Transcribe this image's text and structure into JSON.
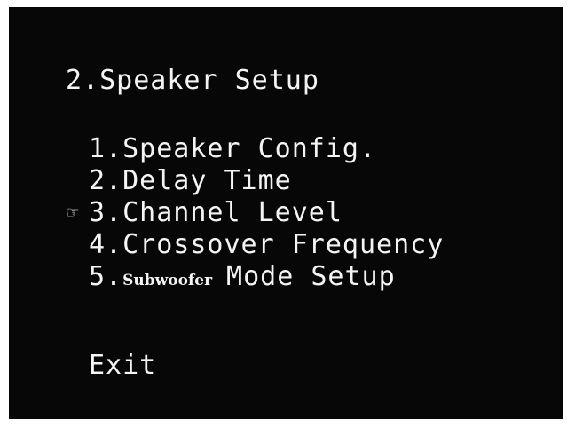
{
  "menu": {
    "title": "2.Speaker Setup",
    "items": [
      {
        "number": "1.",
        "label": "Speaker Config."
      },
      {
        "number": "2.",
        "label": "Delay Time"
      },
      {
        "number": "3.",
        "label": "Channel Level"
      },
      {
        "number": "4.",
        "label": "Crossover Frequency"
      },
      {
        "number": "5.",
        "label_small": "Subwoofer",
        "label": "Mode Setup"
      }
    ],
    "selected_index": 2,
    "pointer_icon": "pointing-hand-icon",
    "exit_label": "Exit"
  },
  "colors": {
    "background": "#070707",
    "text": "#f4f4f4"
  }
}
